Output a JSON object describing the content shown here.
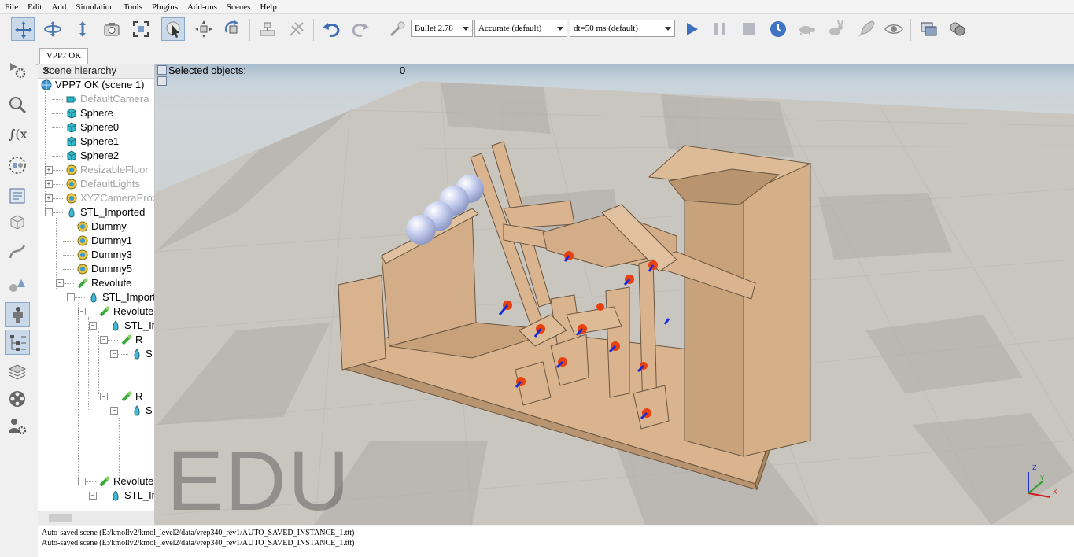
{
  "menu": [
    "File",
    "Edit",
    "Add",
    "Simulation",
    "Tools",
    "Plugins",
    "Add-ons",
    "Scenes",
    "Help"
  ],
  "toolbar": {
    "engine": "Bullet 2.78",
    "accuracy": "Accurate (default)",
    "timestep": "dt=50 ms (default)"
  },
  "tab": {
    "label": "VPP7 OK"
  },
  "hierarchy": {
    "title": "Scene hierarchy",
    "nodes": [
      {
        "label": "VPP7 OK (scene 1)",
        "icon": "scene-icon"
      },
      {
        "label": "DefaultCamera",
        "icon": "camera-icon"
      },
      {
        "label": "Sphere",
        "icon": "shape-icon"
      },
      {
        "label": "Sphere0",
        "icon": "shape-icon"
      },
      {
        "label": "Sphere1",
        "icon": "shape-icon"
      },
      {
        "label": "Sphere2",
        "icon": "shape-icon"
      },
      {
        "label": "ResizableFloor",
        "icon": "dummy-icon"
      },
      {
        "label": "DefaultLights",
        "icon": "dummy-icon"
      },
      {
        "label": "XYZCameraProxy",
        "icon": "dummy-icon"
      },
      {
        "label": "STL_Imported",
        "icon": "mesh-icon"
      },
      {
        "label": "Dummy",
        "icon": "dummy-icon"
      },
      {
        "label": "Dummy1",
        "icon": "dummy-icon"
      },
      {
        "label": "Dummy3",
        "icon": "dummy-icon"
      },
      {
        "label": "Dummy5",
        "icon": "dummy-icon"
      },
      {
        "label": "Revolute",
        "icon": "joint-icon"
      },
      {
        "label": "STL_Imported",
        "icon": "mesh-icon"
      },
      {
        "label": "Revolute",
        "icon": "joint-icon"
      },
      {
        "label": "STL_Imported",
        "icon": "mesh-icon"
      },
      {
        "label": "R",
        "icon": "joint-icon"
      },
      {
        "label": "S",
        "icon": "mesh-icon"
      },
      {
        "label": "R",
        "icon": "joint-icon"
      },
      {
        "label": "S",
        "icon": "mesh-icon"
      },
      {
        "label": "Revolute",
        "icon": "joint-icon"
      },
      {
        "label": "STL_Imported",
        "icon": "mesh-icon"
      }
    ]
  },
  "viewport": {
    "selected_label": "Selected objects:",
    "selected_count": "0",
    "watermark": "EDU"
  },
  "console": [
    "Auto-saved scene (E:/kmollv2/kmol_level2/data/vrep340_rev1/AUTO_SAVED_INSTANCE_1.ttt)",
    "Auto-saved scene (E:/kmollv2/kmol_level2/data/vrep340_rev1/AUTO_SAVED_INSTANCE_1.ttt)"
  ],
  "colors": {
    "wood": "#d9b48f",
    "pin": "#e8400f",
    "axis": "#1a2bd8",
    "sphere": "#c5cdee",
    "floor_light": "#d4d0c9",
    "floor_dark": "#aba8a3",
    "active_button": "#c9d9ea"
  }
}
